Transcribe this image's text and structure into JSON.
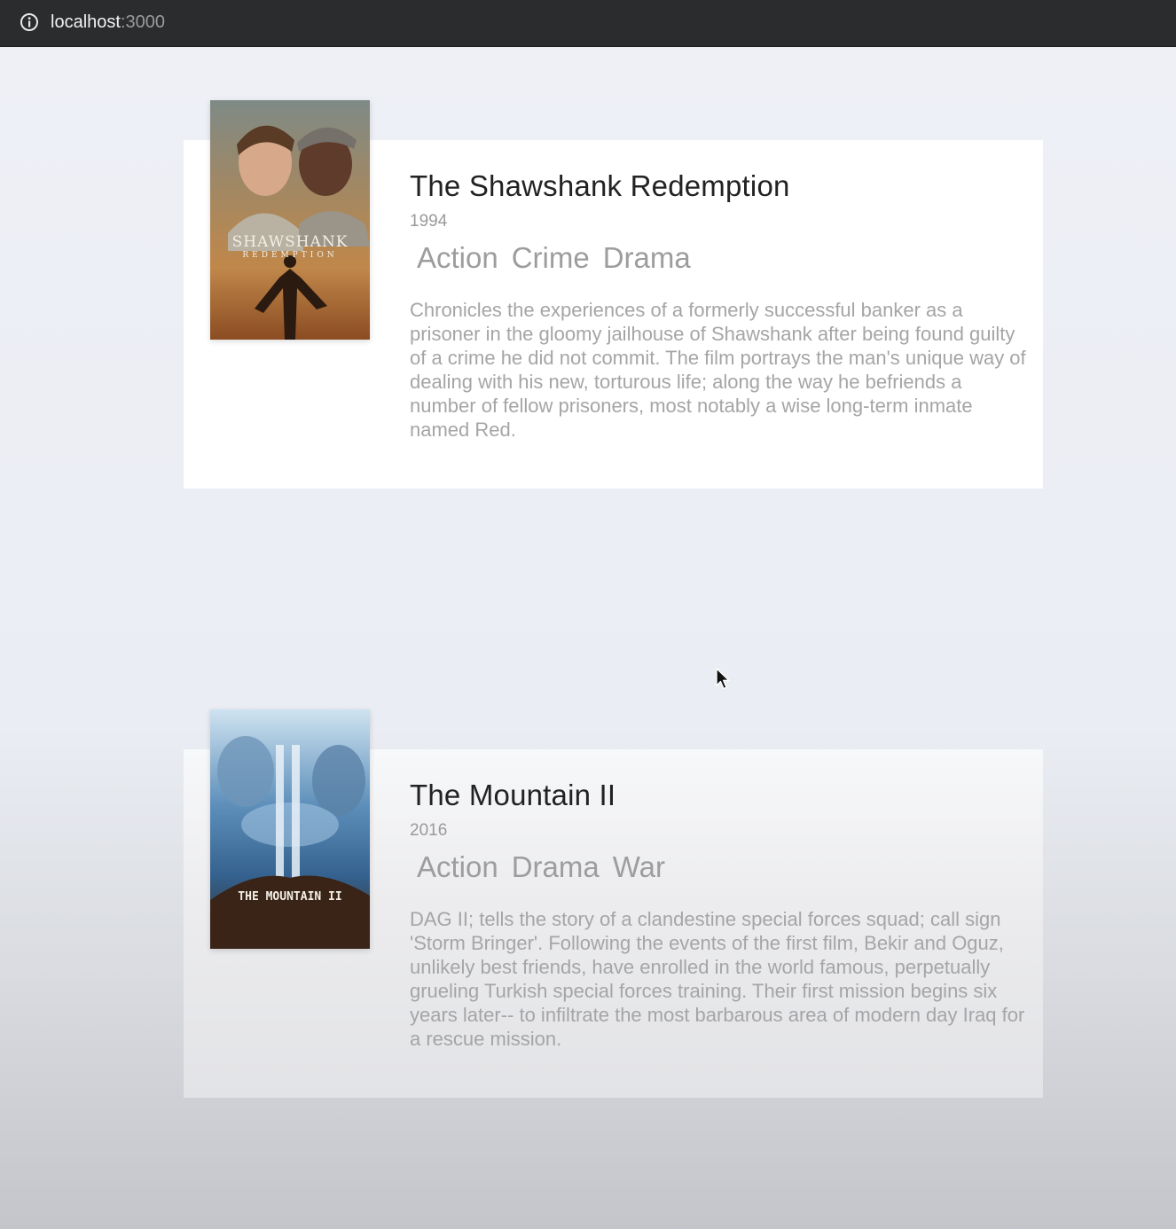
{
  "browser": {
    "url_host": "localhost",
    "url_port": ":3000",
    "info_icon": "info-icon"
  },
  "movies": [
    {
      "title": "The Shawshank Redemption",
      "year": "1994",
      "genres": [
        "Action",
        "Crime",
        "Drama"
      ],
      "description": "Chronicles the experiences of a formerly successful banker as a prisoner in the gloomy jailhouse of Shawshank after being found guilty of a crime he did not commit. The film portrays the man's unique way of dealing with his new, torturous life; along the way he befriends a number of fellow prisoners, most notably a wise long-term inmate named Red.",
      "poster_text": "SHAWSHANK",
      "poster_subtext": "REDEMPTION"
    },
    {
      "title": "The Mountain II",
      "year": "2016",
      "genres": [
        "Action",
        "Drama",
        "War"
      ],
      "description": "DAG II; tells the story of a clandestine special forces squad; call sign 'Storm Bringer'. Following the events of the first film, Bekir and Oguz, unlikely best friends, have enrolled in the world famous, perpetually grueling Turkish special forces training. Their first mission begins six years later-- to infiltrate the most barbarous area of modern day Iraq for a rescue mission.",
      "poster_text": "THE MOUNTAIN II"
    }
  ],
  "colors": {
    "topbar": "#2b2c2e",
    "title": "#222222",
    "muted_text": "#9d9d9d"
  }
}
